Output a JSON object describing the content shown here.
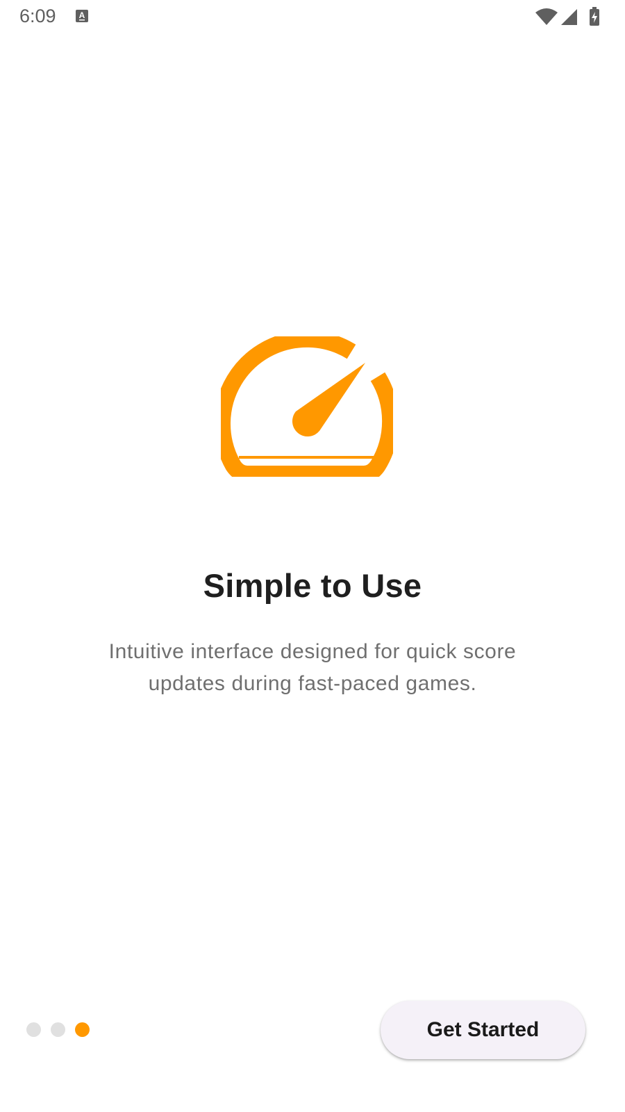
{
  "status_bar": {
    "time": "6:09",
    "notification_icon": "text-a-icon",
    "icons": [
      "wifi-icon",
      "cell-signal-icon",
      "battery-charging-icon"
    ]
  },
  "onboarding": {
    "illustration_icon": "speedometer-icon",
    "accent_color": "#FF9800",
    "title": "Simple to Use",
    "description": "Intuitive interface designed for quick score updates during fast-paced games."
  },
  "pager": {
    "page_count": 3,
    "current_page": 3,
    "active_color": "#FF9800",
    "inactive_color": "#E0E0E0"
  },
  "actions": {
    "get_started_label": "Get Started"
  }
}
